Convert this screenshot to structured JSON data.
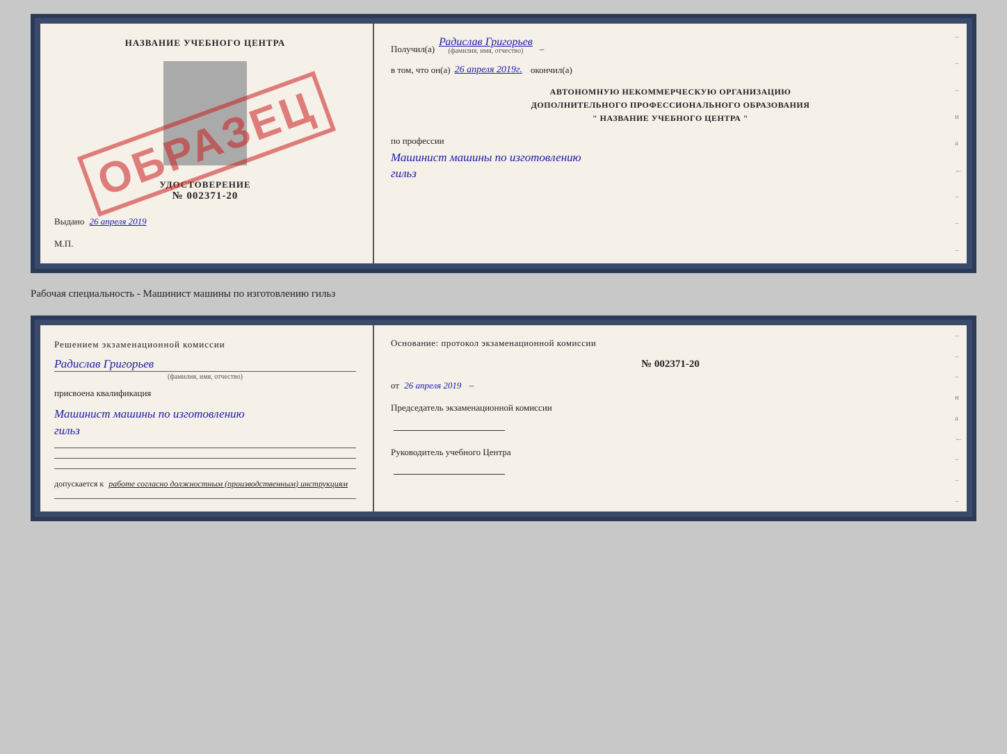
{
  "top_cert": {
    "left": {
      "title": "НАЗВАНИЕ УЧЕБНОГО ЦЕНТРА",
      "udost_label": "УДОСТОВЕРЕНИЕ",
      "udost_num": "№ 002371-20",
      "vydano_prefix": "Выдано",
      "vydano_date": "26 апреля 2019",
      "mp": "М.П.",
      "stamp": "ОБРАЗЕЦ"
    },
    "right": {
      "poluchil_prefix": "Получил(а)",
      "poluchil_name": "Радислав Григорьев",
      "fio_label": "(фамилия, имя, отчество)",
      "vtom_prefix": "в том, что он(а)",
      "vtom_date": "26 апреля 2019г.",
      "okoncil": "окончил(а)",
      "org_line1": "АВТОНОМНУЮ НЕКОММЕРЧЕСКУЮ ОРГАНИЗАЦИЮ",
      "org_line2": "ДОПОЛНИТЕЛЬНОГО ПРОФЕССИОНАЛЬНОГО ОБРАЗОВАНИЯ",
      "org_name": "\"  НАЗВАНИЕ УЧЕБНОГО ЦЕНТРА  \"",
      "po_professii": "по профессии",
      "professiya": "Машинист машины по изготовлению",
      "professiya2": "гильз"
    }
  },
  "specialty_label": "Рабочая специальность - Машинист машины по изготовлению гильз",
  "bottom_cert": {
    "left": {
      "resheniem": "Решением  экзаменационной  комиссии",
      "fio": "Радислав Григорьев",
      "fio_label": "(фамилия, имя, отчество)",
      "prisvoena": "присвоена квалификация",
      "kvali": "Машинист машины по изготовлению",
      "kvali2": "гильз",
      "dopusk_prefix": "допускается к",
      "dopusk_text": "работе согласно должностным (производственным) инструкциям"
    },
    "right": {
      "osnov": "Основание: протокол экзаменационной  комиссии",
      "number": "№  002371-20",
      "ot_prefix": "от",
      "ot_date": "26 апреля 2019",
      "predsedatel_title": "Председатель экзаменационной комиссии",
      "rukovoditel_title": "Руководитель учебного Центра"
    }
  },
  "margin_marks": [
    "-",
    "-",
    "-",
    "и",
    "а",
    "←",
    "-",
    "-",
    "-"
  ],
  "margin_marks2": [
    "-",
    "-",
    "-",
    "и",
    "а",
    "←",
    "-",
    "-",
    "-"
  ]
}
